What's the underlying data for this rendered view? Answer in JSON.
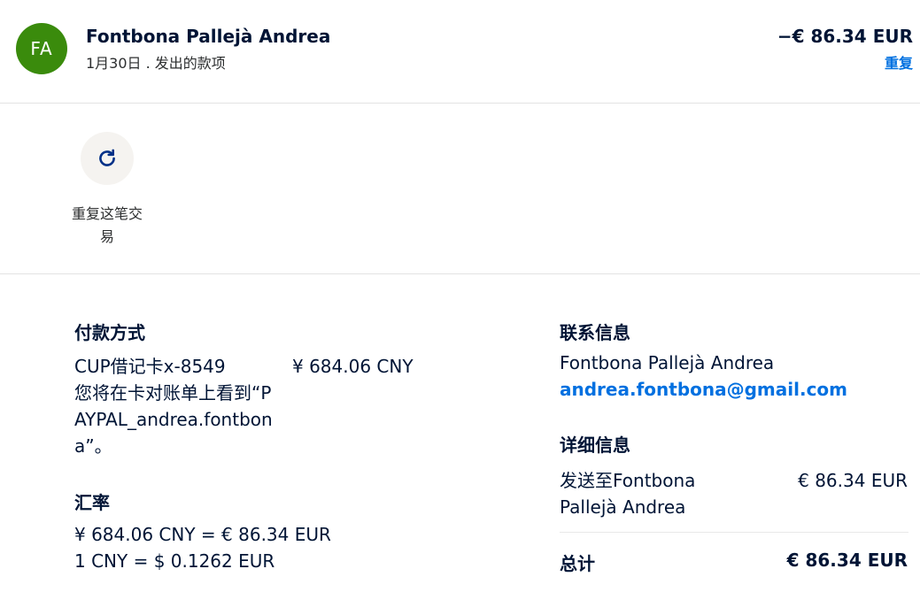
{
  "header": {
    "avatar_initials": "FA",
    "avatar_color": "#3a8b0c",
    "merchant_name": "Fontbona Pallejà Andrea",
    "subtitle": "1月30日 . 发出的款项",
    "amount": "−€ 86.34 EUR",
    "repeat_label": "重复"
  },
  "actions": {
    "repeat_icon": "refresh-icon",
    "repeat_transaction_label": "重复这笔交易"
  },
  "payment_method": {
    "title": "付款方式",
    "card": "CUP借记卡x-8549",
    "amount": "¥ 684.06 CNY",
    "statement_note": "您将在卡对账单上看到“PAYPAL_andrea.fontbona”。"
  },
  "exchange_rate": {
    "title": "汇率",
    "line1": "¥ 684.06 CNY = € 86.34 EUR",
    "line2": "1 CNY = $ 0.1262 EUR"
  },
  "contact": {
    "title": "联系信息",
    "name": "Fontbona Pallejà Andrea",
    "email": "andrea.fontbona@gmail.com"
  },
  "details": {
    "title": "详细信息",
    "sent_to": "发送至Fontbona Pallejà Andrea",
    "sent_amount": "€ 86.34 EUR",
    "total_label": "总计",
    "total_amount": "€ 86.34 EUR"
  },
  "colors": {
    "accent_link": "#0070e0",
    "text_primary": "#001435"
  }
}
